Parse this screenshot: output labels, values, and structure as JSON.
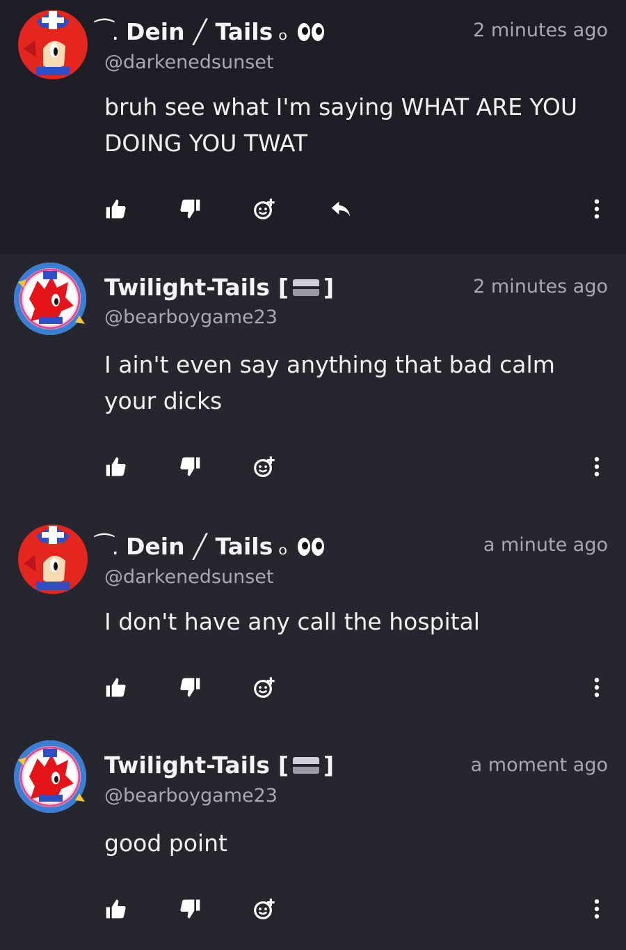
{
  "comments": [
    {
      "author_name_prefix": "͡ .",
      "author_name_first": "Dein",
      "author_name_sep": "╱",
      "author_name_second": "Tails",
      "author_name_suffix": "ₒ",
      "handle": "@darkenedsunset",
      "time": "2 minutes ago",
      "body": "bruh see what I'm saying WHAT ARE YOU DOING YOU TWAT",
      "has_reply": true,
      "avatar": "red-fox-avatar"
    },
    {
      "author_name": "Twilight-Tails",
      "author_badge_open": "[",
      "author_badge_close": "]",
      "handle": "@bearboygame23",
      "time": "2 minutes ago",
      "body": "I ain't even say anything that bad calm your dicks",
      "has_reply": false,
      "avatar": "red-hedgehog-ring-avatar"
    },
    {
      "author_name_prefix": "͡ .",
      "author_name_first": "Dein",
      "author_name_sep": "╱",
      "author_name_second": "Tails",
      "author_name_suffix": "ₒ",
      "handle": "@darkenedsunset",
      "time": "a minute ago",
      "body": "I don't have any call the hospital",
      "has_reply": false,
      "avatar": "red-fox-avatar"
    },
    {
      "author_name": "Twilight-Tails",
      "author_badge_open": "[",
      "author_badge_close": "]",
      "handle": "@bearboygame23",
      "time": "a moment ago",
      "body": "good point",
      "has_reply": false,
      "avatar": "red-hedgehog-ring-avatar"
    }
  ],
  "icons": {
    "like": "thumbs-up-icon",
    "dislike": "thumbs-down-icon",
    "react": "add-reaction-icon",
    "reply": "reply-arrow-icon",
    "more": "kebab-menu-icon"
  },
  "colors": {
    "background": "#25262e",
    "highlight_background": "#1e1f26",
    "text": "#f2f2f4",
    "muted": "#a7a8b4"
  }
}
